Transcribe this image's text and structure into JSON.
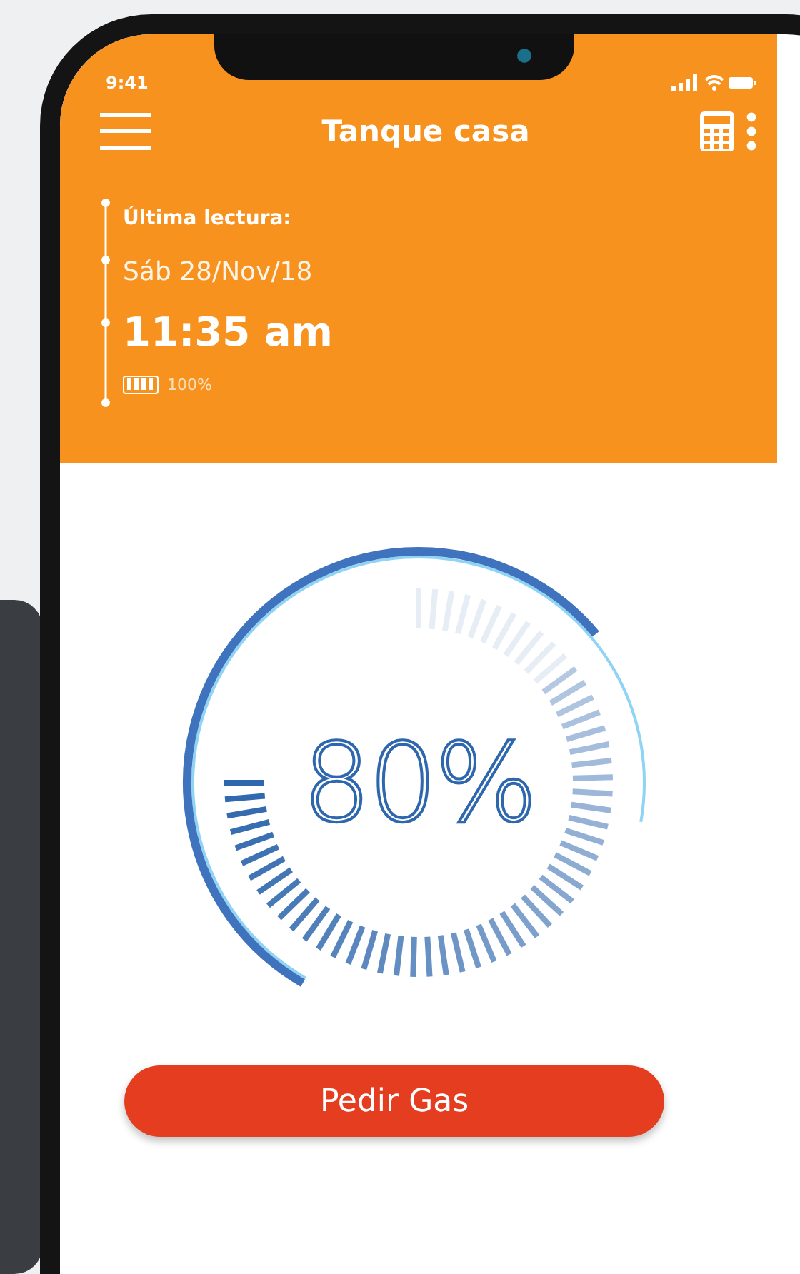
{
  "status_bar": {
    "time": "9:41"
  },
  "header": {
    "title": "Tanque casa"
  },
  "last_reading": {
    "label": "Última lectura:",
    "date": "Sáb 28/Nov/18",
    "time": "11:35 am",
    "battery": {
      "level": 1,
      "reading": "100%"
    }
  },
  "gauge": {
    "reading": "80%"
  },
  "order_button": {
    "label": "Pedir Gas"
  }
}
